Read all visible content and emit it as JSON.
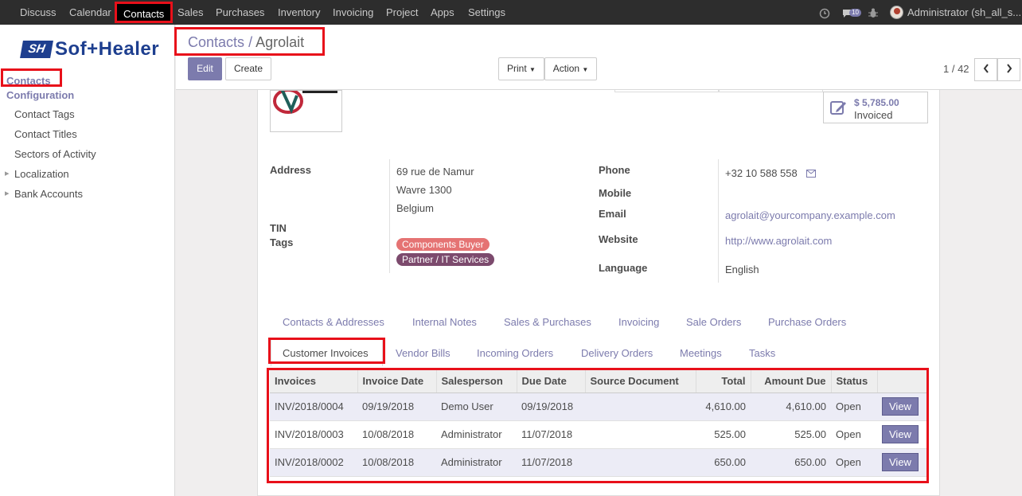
{
  "topbar": {
    "menu": [
      "Discuss",
      "Calendar",
      "Contacts",
      "Sales",
      "Purchases",
      "Inventory",
      "Invoicing",
      "Project",
      "Apps",
      "Settings"
    ],
    "active": "Contacts",
    "message_count": "10",
    "user": "Administrator (sh_all_s..."
  },
  "sidebar": {
    "logo_text": "Sof+Healer",
    "logo_mark": "SH",
    "items": {
      "contacts": "Contacts",
      "configuration": "Configuration",
      "contact_tags": "Contact Tags",
      "contact_titles": "Contact Titles",
      "sectors": "Sectors of Activity",
      "localization": "Localization",
      "bank_accounts": "Bank Accounts"
    }
  },
  "breadcrumb": {
    "parent": "Contacts",
    "separator": "/",
    "current": "Agrolait"
  },
  "buttons": {
    "edit": "Edit",
    "create": "Create",
    "print": "Print",
    "action": "Action"
  },
  "pager": {
    "text": "1 / 42"
  },
  "stat": {
    "amount": "$ 5,785.00",
    "label": "Invoiced"
  },
  "form": {
    "labels": {
      "address": "Address",
      "tin": "TIN",
      "tags": "Tags",
      "phone": "Phone",
      "mobile": "Mobile",
      "email": "Email",
      "website": "Website",
      "language": "Language"
    },
    "address_line1": "69 rue de Namur",
    "address_line2": "Wavre 1300",
    "address_line3": "Belgium",
    "tags": [
      "Components Buyer",
      "Partner / IT Services"
    ],
    "phone": "+32 10 588 558",
    "email": "agrolait@yourcompany.example.com",
    "website": "http://www.agrolait.com",
    "language": "English"
  },
  "tabs": {
    "row1": [
      "Contacts & Addresses",
      "Internal Notes",
      "Sales & Purchases",
      "Invoicing",
      "Sale Orders",
      "Purchase Orders"
    ],
    "row2": [
      "Customer Invoices",
      "Vendor Bills",
      "Incoming Orders",
      "Delivery Orders",
      "Meetings",
      "Tasks"
    ],
    "active": "Customer Invoices"
  },
  "table": {
    "columns": [
      "Invoices",
      "Invoice Date",
      "Salesperson",
      "Due Date",
      "Source Document",
      "Total",
      "Amount Due",
      "Status",
      ""
    ],
    "rows": [
      [
        "INV/2018/0004",
        "09/19/2018",
        "Demo User",
        "09/19/2018",
        "",
        "4,610.00",
        "4,610.00",
        "Open",
        "View"
      ],
      [
        "INV/2018/0003",
        "10/08/2018",
        "Administrator",
        "11/07/2018",
        "",
        "525.00",
        "525.00",
        "Open",
        "View"
      ],
      [
        "INV/2018/0002",
        "10/08/2018",
        "Administrator",
        "11/07/2018",
        "",
        "650.00",
        "650.00",
        "Open",
        "View"
      ]
    ]
  },
  "colors": {
    "accent": "#7c7bad",
    "highlight": "#e8101a",
    "tag1": "#e57373",
    "tag2": "#7c4a6d"
  }
}
